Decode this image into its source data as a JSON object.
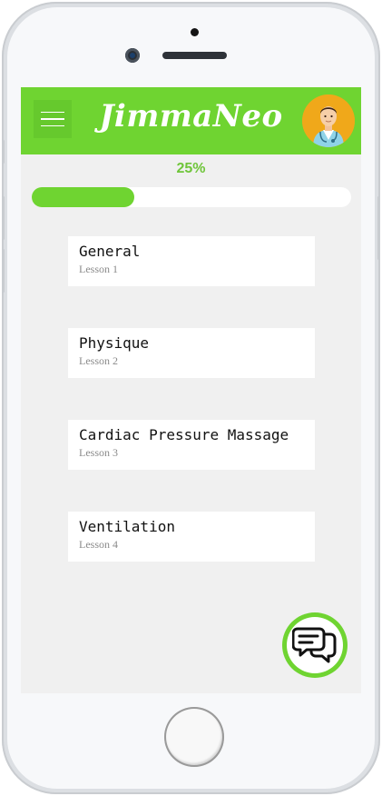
{
  "app": {
    "title": "JimmaNeo",
    "accent_color": "#6fd431"
  },
  "header": {
    "menu_icon": "hamburger-menu-icon",
    "avatar_icon": "doctor-avatar-icon"
  },
  "progress": {
    "label": "25%",
    "value": 0.25
  },
  "lessons": [
    {
      "title": "General",
      "subtitle": "Lesson 1"
    },
    {
      "title": "Physique",
      "subtitle": "Lesson 2"
    },
    {
      "title": "Cardiac Pressure Massage",
      "subtitle": "Lesson 3"
    },
    {
      "title": "Ventilation",
      "subtitle": "Lesson 4"
    }
  ],
  "chat": {
    "icon": "chat-bubbles-icon"
  }
}
